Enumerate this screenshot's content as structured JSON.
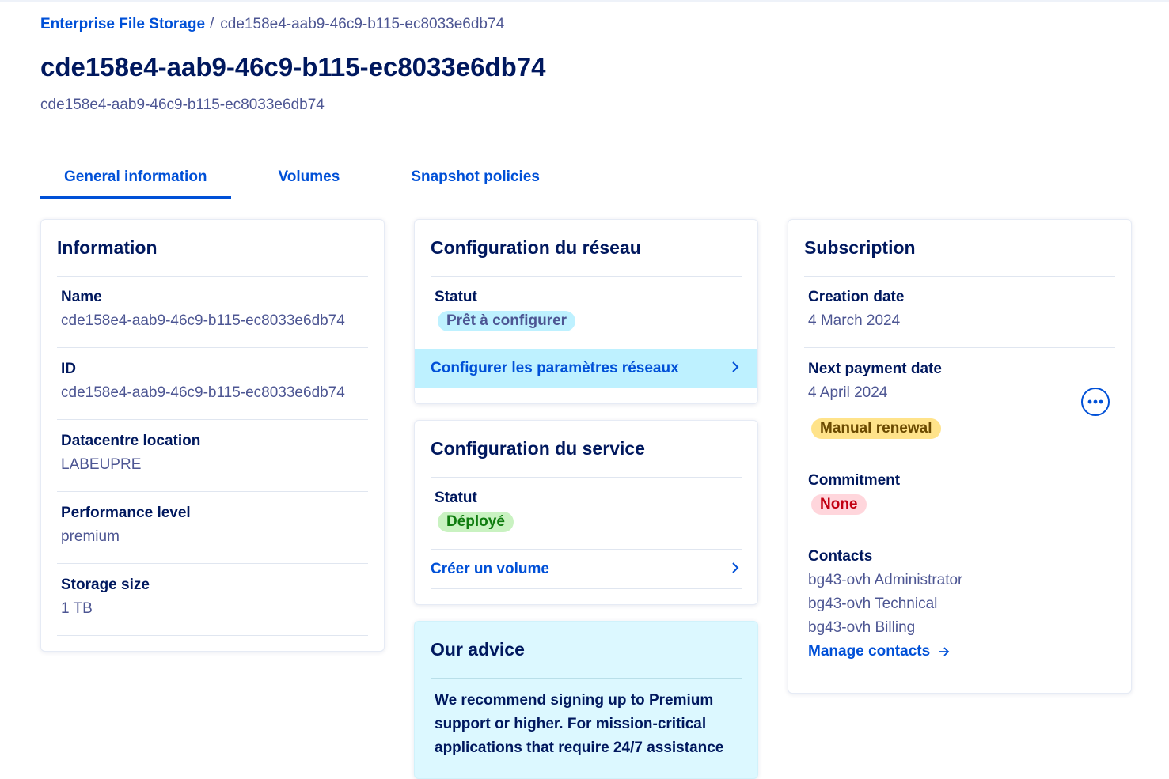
{
  "breadcrumb": {
    "parent": "Enterprise File Storage",
    "separator": "/",
    "current": "cde158e4-aab9-46c9-b115-ec8033e6db74"
  },
  "page": {
    "title": "cde158e4-aab9-46c9-b115-ec8033e6db74",
    "subtitle": "cde158e4-aab9-46c9-b115-ec8033e6db74"
  },
  "tabs": [
    {
      "label": "General information",
      "active": true
    },
    {
      "label": "Volumes",
      "active": false
    },
    {
      "label": "Snapshot policies",
      "active": false
    }
  ],
  "information": {
    "title": "Information",
    "rows": [
      {
        "label": "Name",
        "value": "cde158e4-aab9-46c9-b115-ec8033e6db74"
      },
      {
        "label": "ID",
        "value": "cde158e4-aab9-46c9-b115-ec8033e6db74"
      },
      {
        "label": "Datacentre location",
        "value": "LABEUPRE"
      },
      {
        "label": "Performance level",
        "value": "premium"
      },
      {
        "label": "Storage size",
        "value": "1 TB"
      }
    ]
  },
  "network": {
    "title": "Configuration du réseau",
    "status_label": "Statut",
    "status_value": "Prêt à configurer",
    "action": "Configurer les paramètres réseaux",
    "action_icon": "chevron-right-icon"
  },
  "service": {
    "title": "Configuration du service",
    "status_label": "Statut",
    "status_value": "Déployé",
    "action": "Créer un volume",
    "action_icon": "chevron-right-icon"
  },
  "advice": {
    "title": "Our advice",
    "text": "We recommend signing up to Premium support or higher. For mission-critical applications that require 24/7 assistance"
  },
  "subscription": {
    "title": "Subscription",
    "creation_label": "Creation date",
    "creation_value": "4 March 2024",
    "payment_label": "Next payment date",
    "payment_value": "4 April 2024",
    "renewal_badge": "Manual renewal",
    "more_icon": "more-options-icon",
    "commitment_label": "Commitment",
    "commitment_value": "None",
    "contacts_label": "Contacts",
    "contacts": [
      "bg43-ovh Administrator",
      "bg43-ovh Technical",
      "bg43-ovh Billing"
    ],
    "manage_link": "Manage contacts",
    "manage_icon": "arrow-right-icon"
  },
  "colors": {
    "primary": "#0050d7",
    "heading": "#00185e",
    "muted": "#4d5693",
    "info_bg": "#bef1ff",
    "success_bg": "#c9f2c1",
    "success_fg": "#0f7c0f",
    "warning_bg": "#ffe38a",
    "warning_fg": "#6b4a00",
    "error_bg": "#ffd6dc",
    "error_fg": "#c20012",
    "advice_bg": "#dcf8ff"
  }
}
